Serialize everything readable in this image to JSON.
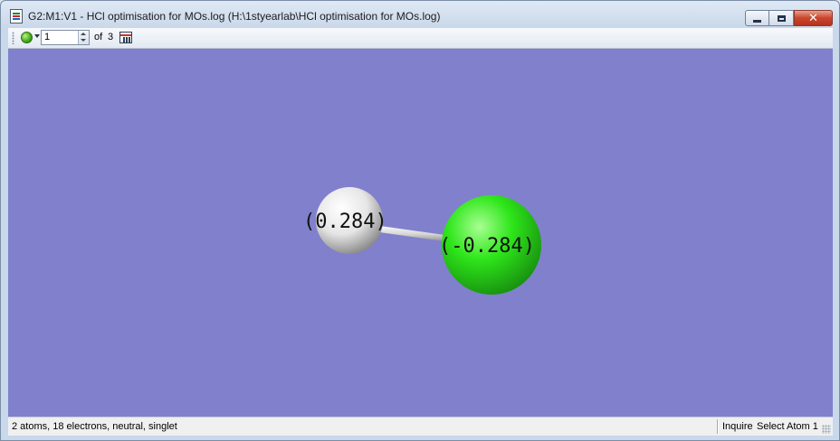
{
  "window": {
    "title": "G2:M1:V1 - HCl optimisation for MOs.log (H:\\1styearlab\\HCl optimisation for MOs.log)",
    "close_glyph": "✕"
  },
  "toolbar": {
    "frame_value": "1",
    "of_label": "of",
    "total_frames": "3",
    "icons": [
      "grip",
      "green-ball-icon",
      "dropdown-arrow-icon",
      "spin-buttons",
      "frame-table-icon"
    ]
  },
  "viewport": {
    "background_color": "#8080cc",
    "atoms": [
      {
        "element": "H",
        "charge_label": "(0.284)",
        "color": "#e8e8e8"
      },
      {
        "element": "Cl",
        "charge_label": "(-0.284)",
        "color": "#2ee61a"
      }
    ],
    "bond_color": "#d7d7d7"
  },
  "statusbar": {
    "left_text": "2 atoms, 18 electrons, neutral, singlet",
    "mode_text": "Inquire",
    "action_text": "Select Atom 1"
  }
}
